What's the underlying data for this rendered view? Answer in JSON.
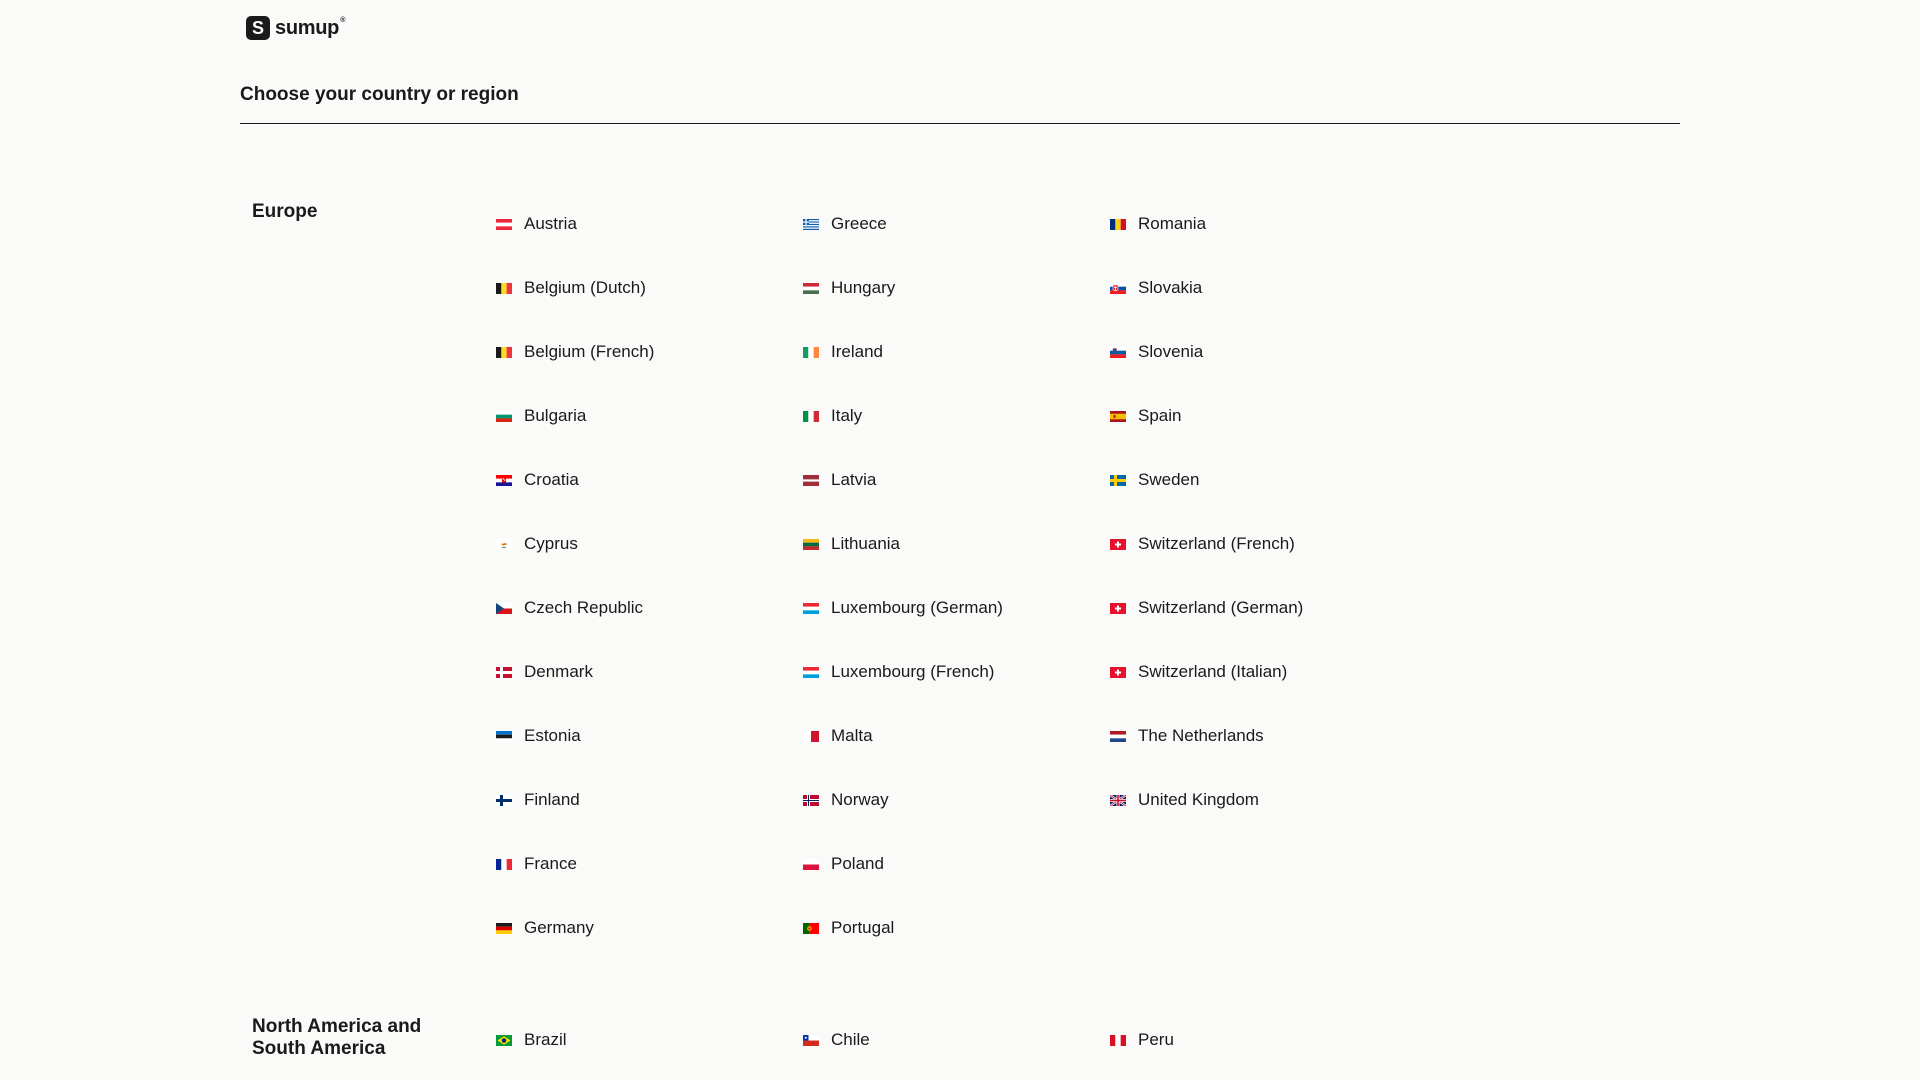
{
  "brand": {
    "logo_text": "sumup",
    "logo_mark": "S"
  },
  "page_title": "Choose your country or region",
  "regions": [
    {
      "label": "Europe",
      "countries": [
        {
          "label": "Austria",
          "flag": "flag-austria-icon"
        },
        {
          "label": "Belgium (Dutch)",
          "flag": "flag-belgium-icon"
        },
        {
          "label": "Belgium (French)",
          "flag": "flag-belgium-icon"
        },
        {
          "label": "Bulgaria",
          "flag": "flag-bulgaria-icon"
        },
        {
          "label": "Croatia",
          "flag": "flag-croatia-icon"
        },
        {
          "label": "Cyprus",
          "flag": "flag-cyprus-icon"
        },
        {
          "label": "Czech Republic",
          "flag": "flag-czech-republic-icon"
        },
        {
          "label": "Denmark",
          "flag": "flag-denmark-icon"
        },
        {
          "label": "Estonia",
          "flag": "flag-estonia-icon"
        },
        {
          "label": "Finland",
          "flag": "flag-finland-icon"
        },
        {
          "label": "France",
          "flag": "flag-france-icon"
        },
        {
          "label": "Germany",
          "flag": "flag-germany-icon"
        },
        {
          "label": "Greece",
          "flag": "flag-greece-icon"
        },
        {
          "label": "Hungary",
          "flag": "flag-hungary-icon"
        },
        {
          "label": "Ireland",
          "flag": "flag-ireland-icon"
        },
        {
          "label": "Italy",
          "flag": "flag-italy-icon"
        },
        {
          "label": "Latvia",
          "flag": "flag-latvia-icon"
        },
        {
          "label": "Lithuania",
          "flag": "flag-lithuania-icon"
        },
        {
          "label": "Luxembourg (German)",
          "flag": "flag-luxembourg-icon"
        },
        {
          "label": "Luxembourg (French)",
          "flag": "flag-luxembourg-icon"
        },
        {
          "label": "Malta",
          "flag": "flag-malta-icon"
        },
        {
          "label": "Norway",
          "flag": "flag-norway-icon"
        },
        {
          "label": "Poland",
          "flag": "flag-poland-icon"
        },
        {
          "label": "Portugal",
          "flag": "flag-portugal-icon"
        },
        {
          "label": "Romania",
          "flag": "flag-romania-icon"
        },
        {
          "label": "Slovakia",
          "flag": "flag-slovakia-icon"
        },
        {
          "label": "Slovenia",
          "flag": "flag-slovenia-icon"
        },
        {
          "label": "Spain",
          "flag": "flag-spain-icon"
        },
        {
          "label": "Sweden",
          "flag": "flag-sweden-icon"
        },
        {
          "label": "Switzerland (French)",
          "flag": "flag-switzerland-icon"
        },
        {
          "label": "Switzerland (German)",
          "flag": "flag-switzerland-icon"
        },
        {
          "label": "Switzerland (Italian)",
          "flag": "flag-switzerland-icon"
        },
        {
          "label": "The Netherlands",
          "flag": "flag-netherlands-icon"
        },
        {
          "label": "United Kingdom",
          "flag": "flag-united-kingdom-icon"
        }
      ]
    },
    {
      "label": "North America and South America",
      "countries": [
        {
          "label": "Brazil",
          "flag": "flag-brazil-icon"
        },
        {
          "label": "Chile",
          "flag": "flag-chile-icon"
        },
        {
          "label": "Peru",
          "flag": "flag-peru-icon"
        }
      ]
    }
  ],
  "colors": {
    "background": "#fafaf9",
    "text": "#1a1a1a"
  }
}
